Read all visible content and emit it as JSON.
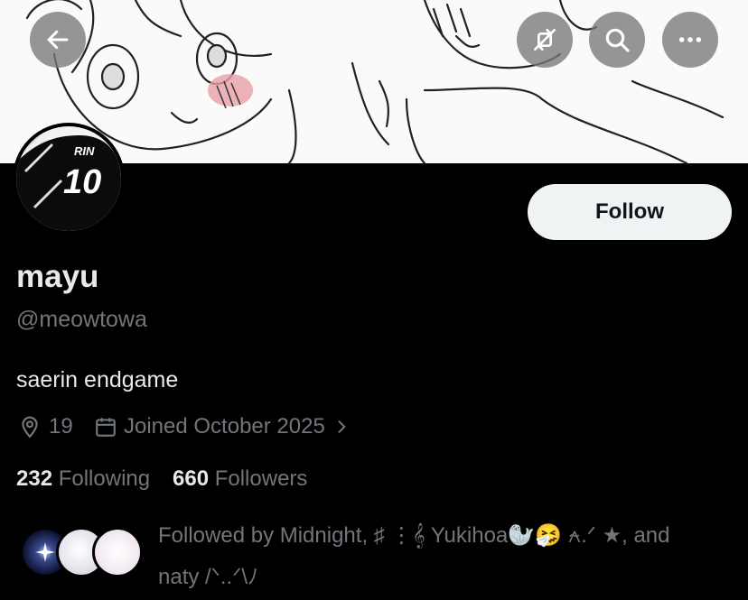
{
  "header": {
    "back_icon": "arrow-left-icon",
    "retweet_off_icon": "repost-off-icon",
    "search_icon": "search-icon",
    "more_icon": "more-icon"
  },
  "avatar": {
    "jersey_name": "RIN",
    "jersey_number": "10"
  },
  "follow_button": {
    "label": "Follow"
  },
  "profile": {
    "display_name": "mayu",
    "handle": "@meowtowa",
    "bio": "saerin endgame",
    "location": "19",
    "joined": "Joined October 2025"
  },
  "stats": {
    "following_count": "232",
    "following_label": "Following",
    "followers_count": "660",
    "followers_label": "Followers"
  },
  "followed_by": {
    "line1": "Followed by Midnight, ♯ ⋮𝄞 Yukihoa🦭🤧 ⍲.ᐟ ★, and",
    "line2": "naty /ᐠ..ᐟ\\ﾉ"
  },
  "colors": {
    "background": "#000000",
    "text_primary": "#e7e9ea",
    "text_secondary": "#71767b",
    "follow_bg": "#eff3f4"
  }
}
